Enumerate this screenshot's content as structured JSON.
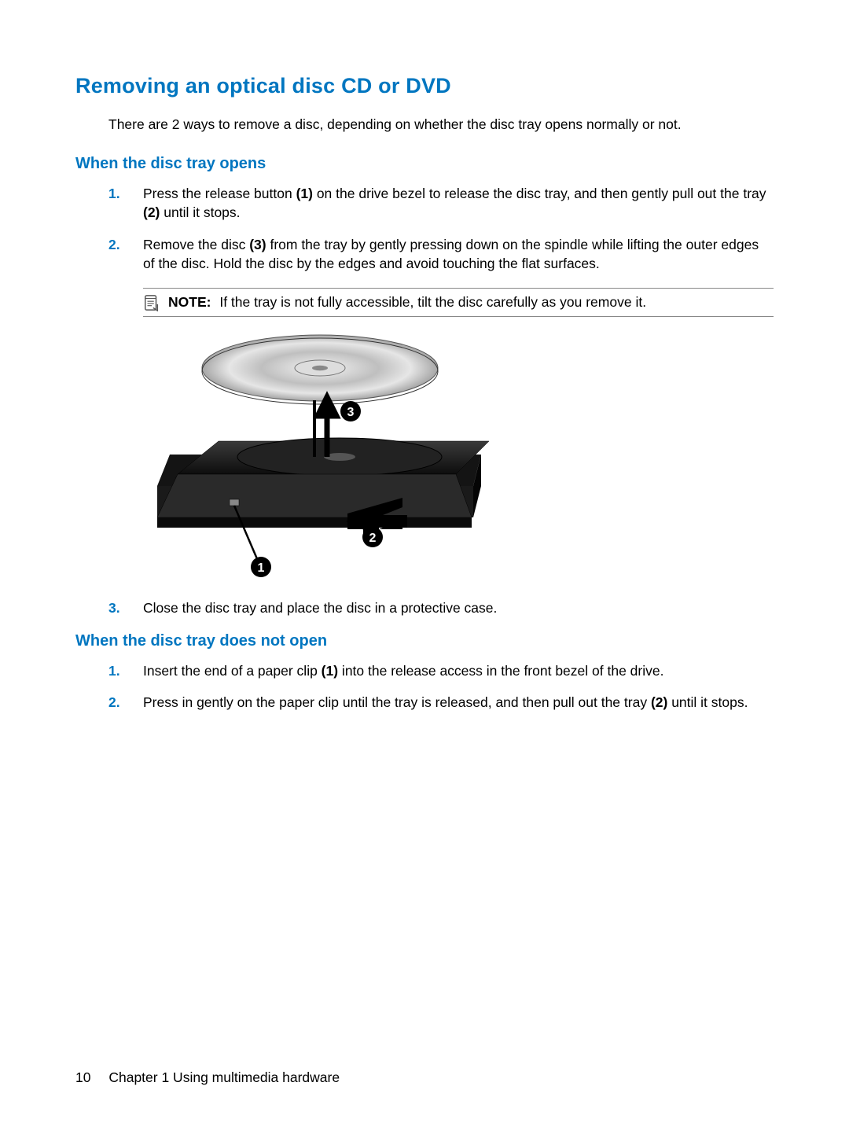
{
  "title": "Removing an optical disc CD or DVD",
  "intro": "There are 2 ways to remove a disc, depending on whether the disc tray opens normally or not.",
  "sectionA": {
    "heading": "When the disc tray opens",
    "steps": [
      {
        "num": "1.",
        "pre": "Press the release button ",
        "b1": "(1)",
        "mid": " on the drive bezel to release the disc tray, and then gently pull out the tray ",
        "b2": "(2)",
        "post": " until it stops."
      },
      {
        "num": "2.",
        "pre": "Remove the disc ",
        "b1": "(3)",
        "mid": " from the tray by gently pressing down on the spindle while lifting the outer edges of the disc. Hold the disc by the edges and avoid touching the flat surfaces.",
        "b2": "",
        "post": ""
      },
      {
        "num": "3.",
        "pre": "Close the disc tray and place the disc in a protective case.",
        "b1": "",
        "mid": "",
        "b2": "",
        "post": ""
      }
    ],
    "note": {
      "label": "NOTE:",
      "text": "If the tray is not fully accessible, tilt the disc carefully as you remove it."
    },
    "callouts": {
      "c1": "1",
      "c2": "2",
      "c3": "3"
    }
  },
  "sectionB": {
    "heading": "When the disc tray does not open",
    "steps": [
      {
        "num": "1.",
        "pre": "Insert the end of a paper clip ",
        "b1": "(1)",
        "mid": " into the release access in the front bezel of the drive.",
        "b2": "",
        "post": ""
      },
      {
        "num": "2.",
        "pre": "Press in gently on the paper clip until the tray is released, and then pull out the tray ",
        "b1": "(2)",
        "mid": " until it stops.",
        "b2": "",
        "post": ""
      }
    ]
  },
  "footer": {
    "page": "10",
    "chapter": "Chapter 1   Using multimedia hardware"
  }
}
